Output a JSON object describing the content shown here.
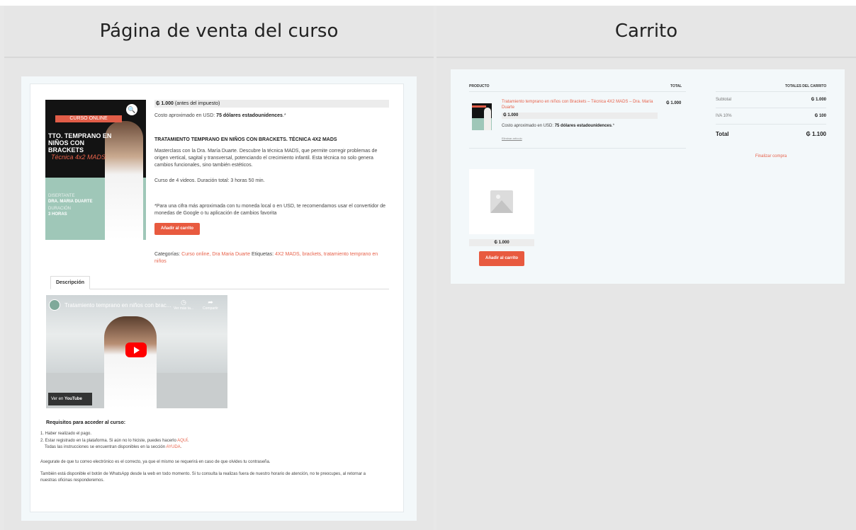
{
  "headers": {
    "left": "Página de venta del curso",
    "right": "Carrito"
  },
  "product": {
    "image": {
      "badge": "CURSO ONLINE",
      "title": "TTO. TEMPRANO EN NIÑOS CON BRACKETS",
      "technique": "Técnica 4x2 MADS",
      "lecturer_label": "DISERTANTE",
      "lecturer": "DRA. MARIA DUARTE",
      "duration_label": "DURACIÓN",
      "duration": "3 HORAS"
    },
    "price": "₲ 1.000",
    "price_note": "(antes del impuesto)",
    "approx_label": "Costo aproximado en USD:",
    "approx_value": "75 dólares estadounidences",
    "approx_suffix": ".*",
    "heading": "TRATAMIENTO TEMPRANO EN NIÑOS CON BRACKETS. TÉCNICA 4X2 MADS",
    "description": "Masterclass con la Dra. María Duarte. Descubre la técnica MADS, que permite corregir problemas de origen vertical, sagital y transversal, potenciando el crecimiento infantil. Esta técnica no solo genera cambios funcionales, sino también estéticos.",
    "course_info": "Curso de 4 videos. Duración total: 3 horas 50 min.",
    "currency_note": "*Para una cifra más aproximada con tu moneda local o en USD, te recomendamos usar el convertidor de monedas de Google o tu aplicación de cambios favorita",
    "add_to_cart": "Añadir al carrito",
    "categories_label": "Categorías:",
    "categories": "Curso online, Dra Maria Duarte",
    "tags_label": "Etiquetas:",
    "tags": "4X2 MADS, brackets, tratamiento temprano en niños"
  },
  "tabs": {
    "description": "Descripción"
  },
  "video": {
    "title": "Tratamiento temprano en niños con brac...",
    "watch_later": "Ver más ta...",
    "share": "Compartir",
    "watch_on": "Ver en",
    "youtube": "YouTube"
  },
  "requirements": {
    "title": "Requisitos para acceder al curso:",
    "item1": "1. Haber realizado el pago.",
    "item2_prefix": "2. Estar registrado en la plataforma. Si aún no lo hiciste, puedes hacerlo",
    "item2_link": "AQUÍ",
    "item2_line2_prefix": "Todas las instrucciones se encuentran disponibles en la sección",
    "item2_line2_link": "AYUDA",
    "email_note": "Asegurate de que tu correo electrónico es el correcto, ya que el mismo se requerirá en caso de que olvides tu contraseña.",
    "whatsapp_note": "También está disponible el botón de WhatsApp desde la web en todo momento. Si tu consulta la realizas fuera de nuestro horario de atención, no te preocupes, al retornar a nuestras oficinas responderemos."
  },
  "cart": {
    "col_product": "PRODUCTO",
    "col_total": "TOTAL",
    "item_name": "Tratamiento temprano en niños con Brackets – Técnica 4X2 MADS – Dra. María Duarte",
    "item_price": "₲ 1.000",
    "item_total": "₲ 1.000",
    "approx_label": "Costo aproximado en USD:",
    "approx_value": "75 dólares estadounidences",
    "approx_suffix": ".*",
    "remove": "Eliminar artículo",
    "totals_header": "TOTALES DEL CARRITO",
    "subtotal_label": "Subtotal",
    "subtotal_value": "₲ 1.000",
    "iva_label": "IVA 10%",
    "iva_value": "₲ 100",
    "total_label": "Total",
    "total_value": "₲ 1.100",
    "checkout": "Finalizar compra",
    "suggested_price": "₲ 1.000",
    "suggested_add": "Añadir al carrito"
  }
}
